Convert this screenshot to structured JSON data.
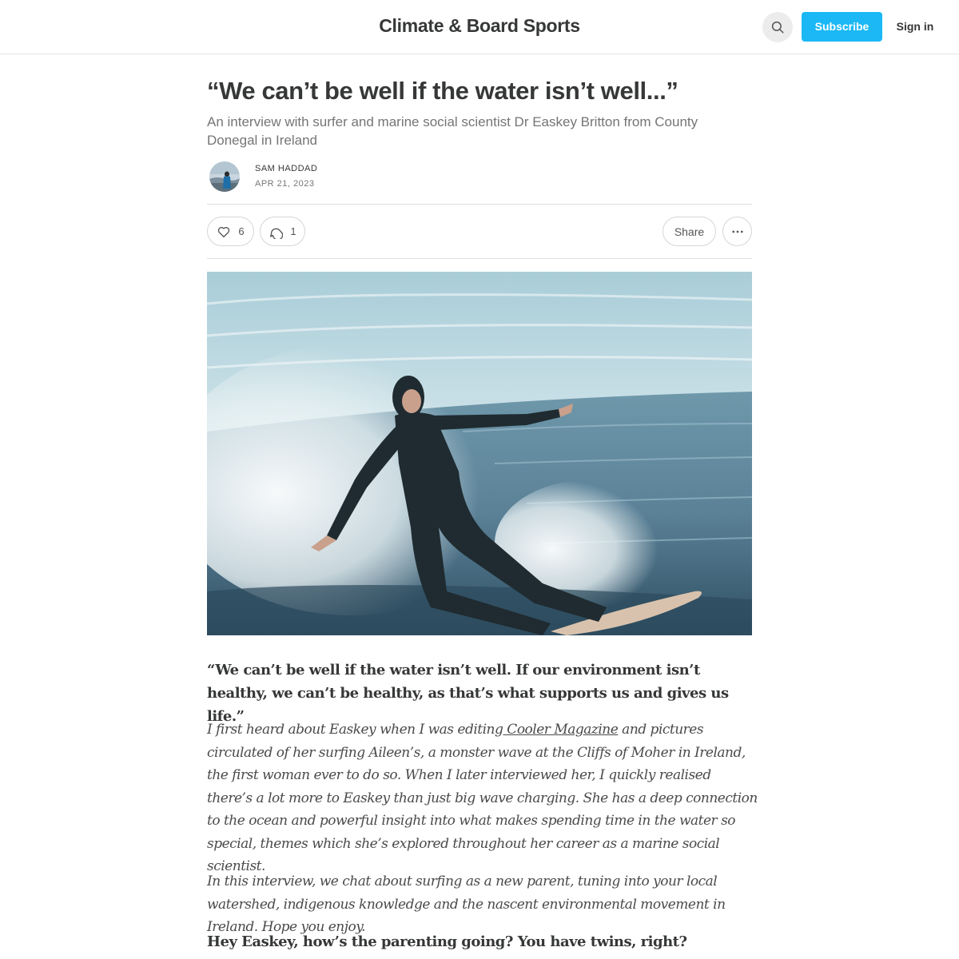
{
  "header": {
    "site_title": "Climate & Board Sports",
    "subscribe_label": "Subscribe",
    "signin_label": "Sign in",
    "search_icon": "search-icon"
  },
  "post": {
    "title": "“We can’t be well if the water isn’t well...”",
    "subtitle": "An interview with surfer and marine social scientist Dr Easkey Britton from County Donegal in Ireland",
    "author": "Sam Haddad",
    "date": "Apr 21, 2023"
  },
  "actions": {
    "like_count": "6",
    "comment_count": "1",
    "share_label": "Share",
    "icons": [
      "heart-icon",
      "comment-icon",
      "ellipsis-icon"
    ]
  },
  "body": {
    "quote": "“We can’t be well if the water isn’t well. If our environment isn’t healthy, we can’t be healthy, as that’s what supports us and gives us life.”",
    "para1_before_link": "I first heard about Easkey when I was editing",
    "para1_link": " Cooler Magazine",
    "para1_after_link": " and pictures circulated of her surfing Aileen’s, a monster wave at the Cliffs of Moher in Ireland, the first woman ever to do so. When I later interviewed her, I quickly realised there’s a lot more to Easkey than just big wave charging. She has a deep connection to the ocean and powerful insight into what makes spending time in the water so special, themes which she’s explored throughout her career as a marine social scientist.",
    "para2": "In this interview, we chat about surfing as a new parent, tuning into your local watershed, indigenous knowledge and the nascent environmental movement in Ireland. Hope you enjoy.",
    "question": "Hey Easkey, how’s the parenting going? You have twins, right?"
  },
  "colors": {
    "accent": "#1bb8f5",
    "text": "#363737",
    "muted": "#757575",
    "border": "#e0e0e0"
  }
}
